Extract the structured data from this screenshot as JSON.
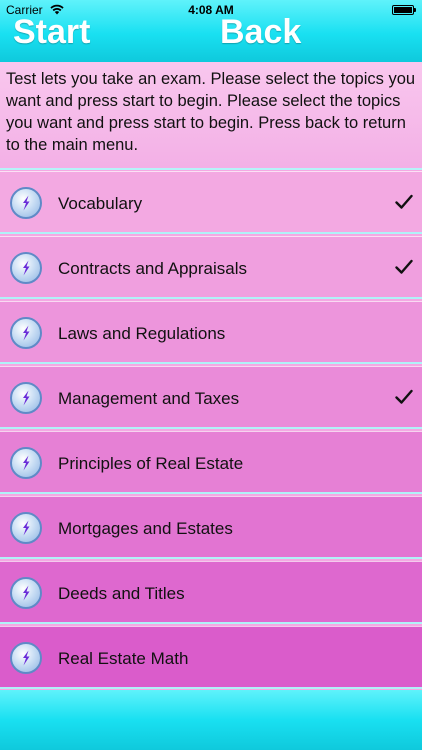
{
  "status_bar": {
    "carrier": "Carrier",
    "time": "4:08 AM"
  },
  "header": {
    "start_label": "Start",
    "back_label": "Back"
  },
  "instructions": "Test lets you take an exam. Please select the topics you want and press start to begin. Please select the topics you want and press start to begin. Press back to return to the main menu.",
  "topics": [
    {
      "label": "Vocabulary",
      "checked": true,
      "bg": "#f3a9e2"
    },
    {
      "label": "Contracts and Appraisals",
      "checked": true,
      "bg": "#f09fdf"
    },
    {
      "label": "Laws and Regulations",
      "checked": false,
      "bg": "#ed95dc"
    },
    {
      "label": "Management and Taxes",
      "checked": true,
      "bg": "#ea8bd9"
    },
    {
      "label": "Principles of Real Estate",
      "checked": false,
      "bg": "#e680d5"
    },
    {
      "label": "Mortgages and Estates",
      "checked": false,
      "bg": "#e274d2"
    },
    {
      "label": "Deeds and Titles",
      "checked": false,
      "bg": "#de68cf"
    },
    {
      "label": "Real Estate Math",
      "checked": false,
      "bg": "#da5ccb"
    }
  ],
  "icons": {
    "row_icon": "lightning-badge-icon",
    "check": "checkmark-icon",
    "wifi": "wifi-icon",
    "battery": "battery-icon"
  },
  "colors": {
    "header": "#19e0f1",
    "instructions_bg": "#f5b8e9",
    "text": "#111111"
  }
}
